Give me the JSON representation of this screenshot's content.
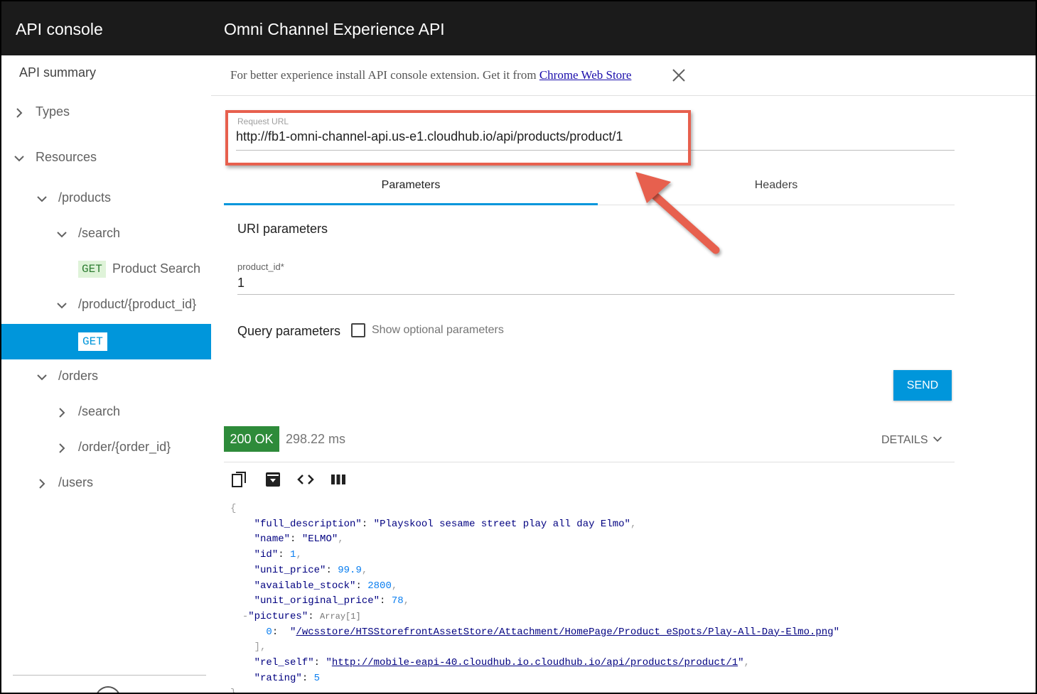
{
  "header": {
    "app_title": "API console",
    "api_title": "Omni Channel Experience API"
  },
  "sidebar": {
    "summary": "API summary",
    "items": [
      {
        "label": "Types"
      },
      {
        "label": "Resources"
      },
      {
        "label": "/products"
      },
      {
        "label": "/search"
      },
      {
        "method": "GET",
        "label": "Product Search"
      },
      {
        "label": "/product/{product_id}"
      },
      {
        "method": "GET",
        "label": ""
      },
      {
        "label": "/orders"
      },
      {
        "label": "/search"
      },
      {
        "label": "/order/{order_id}"
      },
      {
        "label": "/users"
      }
    ]
  },
  "banner": {
    "text": "For better experience install API console extension. Get it from ",
    "link": "Chrome Web Store"
  },
  "request": {
    "url_label": "Request URL",
    "url": "http://fb1-omni-channel-api.us-e1.cloudhub.io/api/products/product/1"
  },
  "tabs": [
    {
      "label": "Parameters",
      "active": true
    },
    {
      "label": "Headers",
      "active": false
    }
  ],
  "params": {
    "uri_title": "URI parameters",
    "product_id_label": "product_id*",
    "product_id_value": "1",
    "query_title": "Query parameters",
    "optional_label": "Show optional parameters"
  },
  "actions": {
    "send": "SEND"
  },
  "response": {
    "status": "200 OK",
    "time": "298.22 ms",
    "details": "DETAILS",
    "status_color": "#2e8b3a"
  },
  "json_response": {
    "full_description": "Playskool sesame street play all day Elmo",
    "name": "ELMO",
    "id": "1",
    "unit_price": "99.9",
    "available_stock": "2800",
    "unit_original_price": "78",
    "pictures_type": "Array[1]",
    "picture_0": "/wcsstore/HTSStorefrontAssetStore/Attachment/HomePage/Product_eSpots/Play-All-Day-Elmo.png",
    "rel_self": "http://mobile-eapi-40.cloudhub.io.cloudhub.io/api/products/product/1",
    "rating": "5"
  },
  "colors": {
    "accent": "#0096db",
    "header_bg": "#1b1b1b",
    "annotation": "#e7604e"
  }
}
